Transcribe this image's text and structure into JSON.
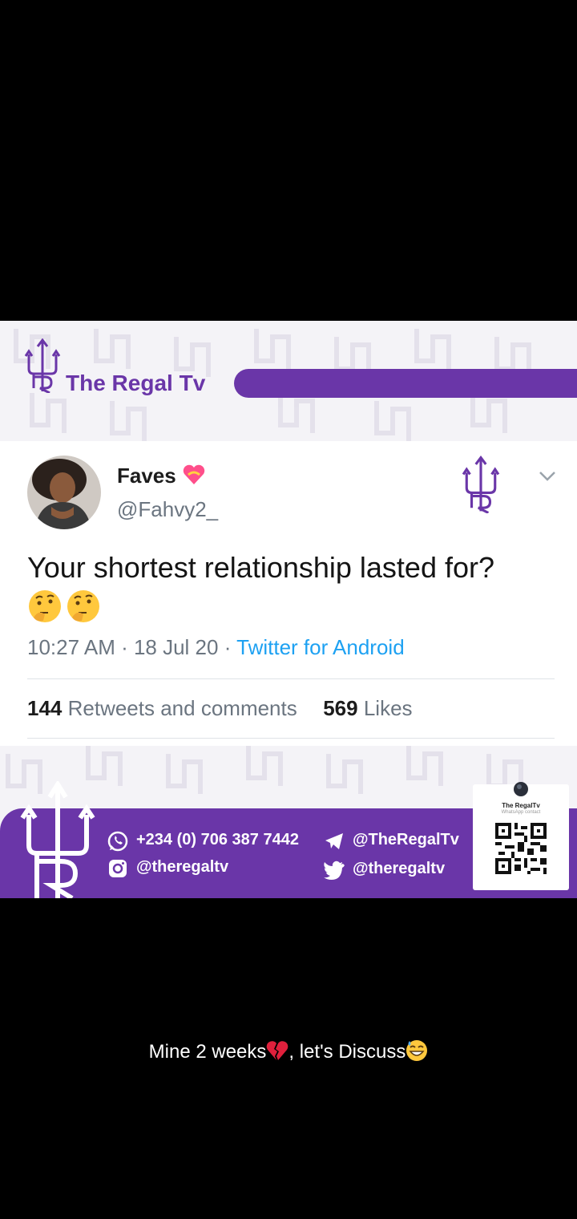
{
  "brand": {
    "name": "The Regal Tv"
  },
  "tweet": {
    "display_name": "Faves",
    "display_name_emoji": "heart-with-ribbon-icon",
    "handle": "@Fahvy2_",
    "text": "Your shortest relationship lasted for?",
    "text_emojis": [
      "thinking-face-icon",
      "thinking-face-icon"
    ],
    "time": "10:27 AM · 18 Jul 20 · ",
    "source": "Twitter for Android",
    "retweets_count": "144",
    "retweets_label": " Retweets and comments",
    "likes_count": "569",
    "likes_label": " Likes"
  },
  "footer": {
    "phone": "+234 (0) 706 387 7442",
    "telegram": "@TheRegalTv",
    "instagram": "@theregaltv",
    "twitter": "@theregaltv",
    "qr_title": "The RegalTv",
    "qr_subtitle": "WhatsApp contact"
  },
  "caption": {
    "text_a": "Mine 2 weeks",
    "text_b": ", let's Discuss"
  },
  "colors": {
    "brand_purple": "#6a36a8",
    "twitter_blue": "#1da1f2",
    "background": "#000000"
  }
}
